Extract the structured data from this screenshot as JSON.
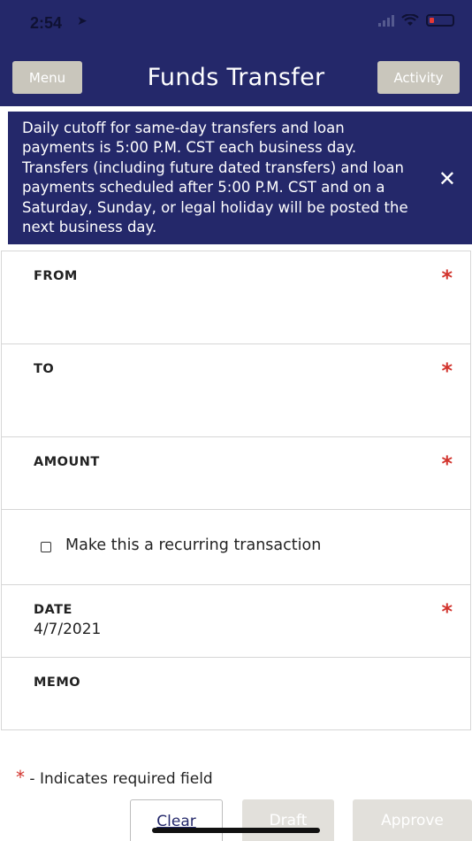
{
  "status_bar": {
    "time": "2:54"
  },
  "header": {
    "title": "Funds Transfer",
    "menu_label": "Menu",
    "activity_label": "Activity",
    "color": "#24286a"
  },
  "banner": {
    "text": "Daily cutoff for same-day transfers and loan payments is 5:00 P.M. CST each business day. Transfers (including future dated transfers) and loan payments scheduled after 5:00 P.M. CST and on a Saturday, Sunday, or legal holiday will be posted the next business day.",
    "close_icon": "✕"
  },
  "form": {
    "from_label": "FROM",
    "to_label": "TO",
    "amount_label": "AMOUNT",
    "recurring_label": "Make this a recurring transaction",
    "date_label": "DATE",
    "date_value": "4/7/2021",
    "memo_label": "MEMO",
    "required_star": "*",
    "required_color": "#d2342d"
  },
  "legend": {
    "star": "*",
    "text": " - Indicates required field"
  },
  "actions": {
    "clear": "Clear",
    "draft": "Draft",
    "approve": "Approve"
  }
}
